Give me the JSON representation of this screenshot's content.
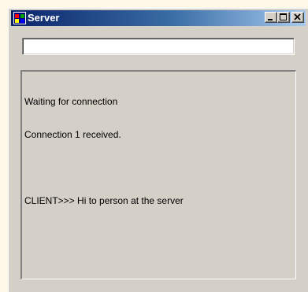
{
  "window": {
    "title": "Server",
    "icon": "app-window-icon",
    "controls": {
      "minimize": "minimize-icon",
      "maximize": "maximize-icon",
      "close": "close-icon"
    }
  },
  "input": {
    "value": "",
    "placeholder": ""
  },
  "display": {
    "lines": [
      "Waiting for connection",
      "Connection 1 received.",
      "",
      "CLIENT>>> Hi to person at the server"
    ]
  },
  "colors": {
    "titlebar_start": "#0a246a",
    "titlebar_end": "#a6caf0",
    "window_bg": "#d4d0c8",
    "page_bg": "#fdf8e8"
  }
}
